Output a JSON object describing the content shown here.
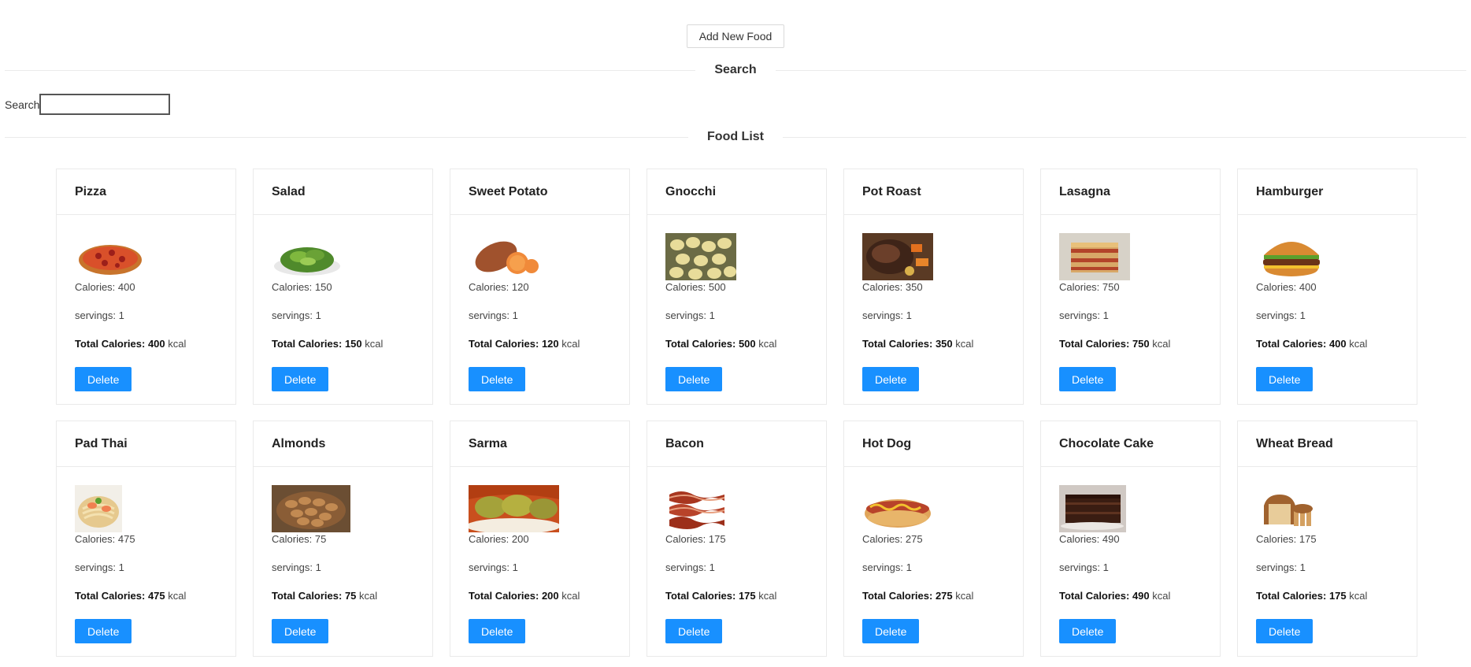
{
  "header": {
    "add_label": "Add New Food"
  },
  "search": {
    "divider_label": "Search",
    "label": "Search",
    "value": "",
    "placeholder": ""
  },
  "list": {
    "divider_label": "Food List"
  },
  "labels": {
    "calories_prefix": "Calories: ",
    "servings_prefix": "servings: ",
    "total_prefix": "Total Calories: ",
    "unit": " kcal",
    "delete": "Delete"
  },
  "foods": [
    {
      "name": "Pizza",
      "calories": "400",
      "servings": "1",
      "total": "400",
      "icon": "pizza"
    },
    {
      "name": "Salad",
      "calories": "150",
      "servings": "1",
      "total": "150",
      "icon": "salad"
    },
    {
      "name": "Sweet Potato",
      "calories": "120",
      "servings": "1",
      "total": "120",
      "icon": "sweet-potato"
    },
    {
      "name": "Gnocchi",
      "calories": "500",
      "servings": "1",
      "total": "500",
      "icon": "gnocchi"
    },
    {
      "name": "Pot Roast",
      "calories": "350",
      "servings": "1",
      "total": "350",
      "icon": "pot-roast"
    },
    {
      "name": "Lasagna",
      "calories": "750",
      "servings": "1",
      "total": "750",
      "icon": "lasagna"
    },
    {
      "name": "Hamburger",
      "calories": "400",
      "servings": "1",
      "total": "400",
      "icon": "hamburger"
    },
    {
      "name": "Pad Thai",
      "calories": "475",
      "servings": "1",
      "total": "475",
      "icon": "pad-thai"
    },
    {
      "name": "Almonds",
      "calories": "75",
      "servings": "1",
      "total": "75",
      "icon": "almonds"
    },
    {
      "name": "Sarma",
      "calories": "200",
      "servings": "1",
      "total": "200",
      "icon": "sarma"
    },
    {
      "name": "Bacon",
      "calories": "175",
      "servings": "1",
      "total": "175",
      "icon": "bacon"
    },
    {
      "name": "Hot Dog",
      "calories": "275",
      "servings": "1",
      "total": "275",
      "icon": "hot-dog"
    },
    {
      "name": "Chocolate Cake",
      "calories": "490",
      "servings": "1",
      "total": "490",
      "icon": "chocolate-cake"
    },
    {
      "name": "Wheat Bread",
      "calories": "175",
      "servings": "1",
      "total": "175",
      "icon": "wheat-bread"
    }
  ],
  "colors": {
    "primary": "#1890ff",
    "border": "#eaeaea",
    "text": "#333333"
  }
}
